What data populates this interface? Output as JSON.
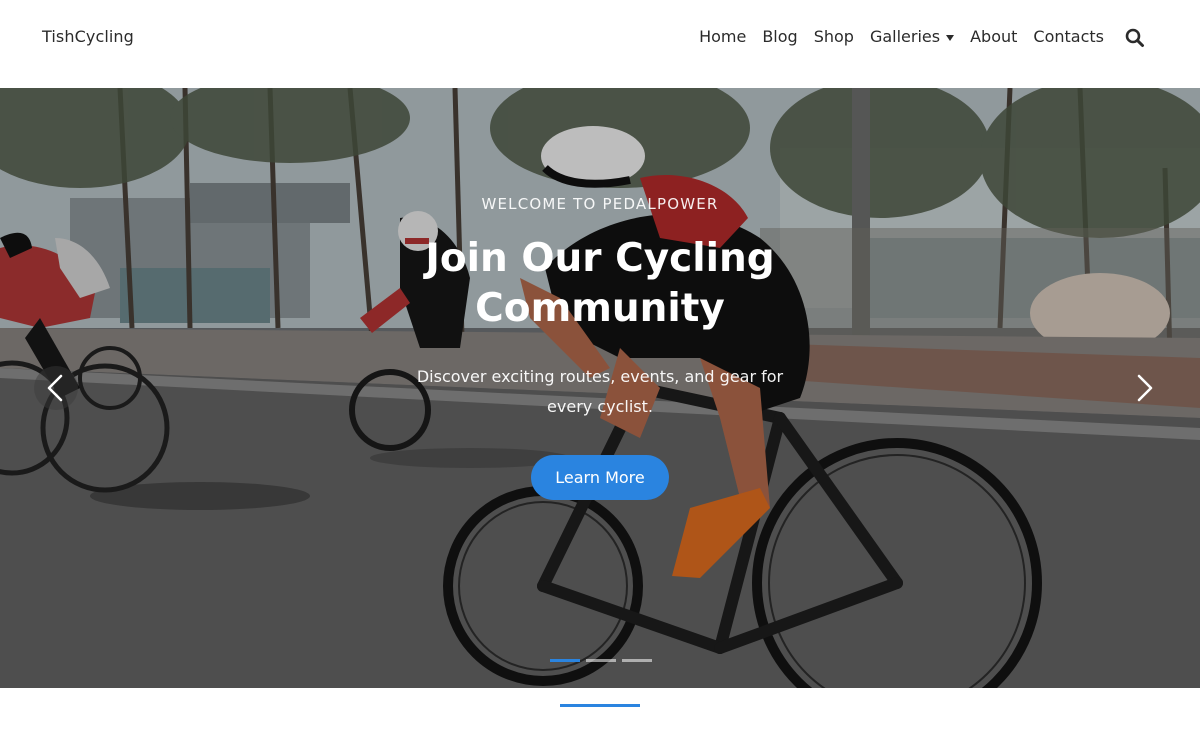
{
  "header": {
    "logo": "TishCycling",
    "nav": [
      {
        "label": "Home"
      },
      {
        "label": "Blog"
      },
      {
        "label": "Shop"
      },
      {
        "label": "Galleries",
        "has_dropdown": true
      },
      {
        "label": "About"
      },
      {
        "label": "Contacts"
      }
    ],
    "search_icon": "search-icon"
  },
  "hero": {
    "eyebrow": "WELCOME TO PEDALPOWER",
    "title": "Join Our Cycling Community",
    "subtitle": "Discover exciting routes, events, and gear for every cyclist.",
    "cta_label": "Learn More",
    "prev_icon": "chevron-left-icon",
    "next_icon": "chevron-right-icon",
    "slides_total": 3,
    "active_slide": 1
  },
  "colors": {
    "accent": "#2a84e0",
    "text": "#2b2b2b",
    "background": "#ffffff"
  }
}
